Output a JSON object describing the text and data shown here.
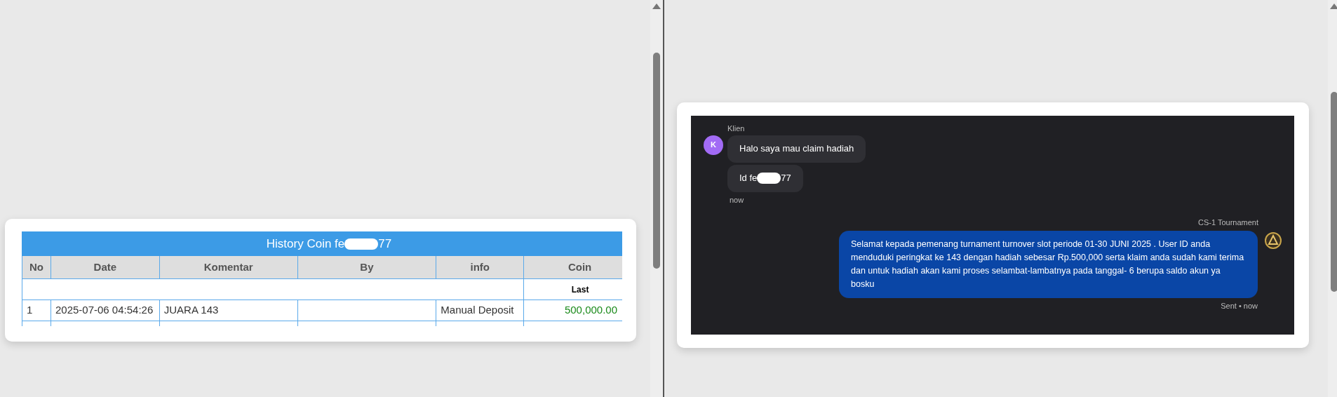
{
  "history": {
    "title_start": "History Coin fe",
    "title_end": "77",
    "columns": [
      "No",
      "Date",
      "Komentar",
      "By",
      "info",
      "Coin"
    ],
    "subheader": "Last",
    "rows": [
      {
        "no": "1",
        "date": "2025-07-06 04:54:26",
        "komentar": "JUARA 143",
        "info": "Manual Deposit",
        "coin": "500,000.00"
      }
    ]
  },
  "chat": {
    "client_name": "Klien",
    "client_initial": "K",
    "client_messages": [
      {
        "text_start": "Halo saya mau claim hadiah"
      },
      {
        "text_start": "Id fe",
        "text_end": "77"
      }
    ],
    "client_time": "now",
    "agent_name": "CS-1 Tournament",
    "agent_message": "Selamat kepada pemenang turnament turnover slot periode 01-30 JUNI 2025 . User ID anda menduduki peringkat ke 143 dengan hadiah sebesar Rp.500,000 serta klaim anda sudah kami terima dan untuk hadiah akan kami proses selambat-lambatnya pada tanggal- 6 berupa saldo akun ya bosku",
    "agent_status": "Sent • now"
  }
}
